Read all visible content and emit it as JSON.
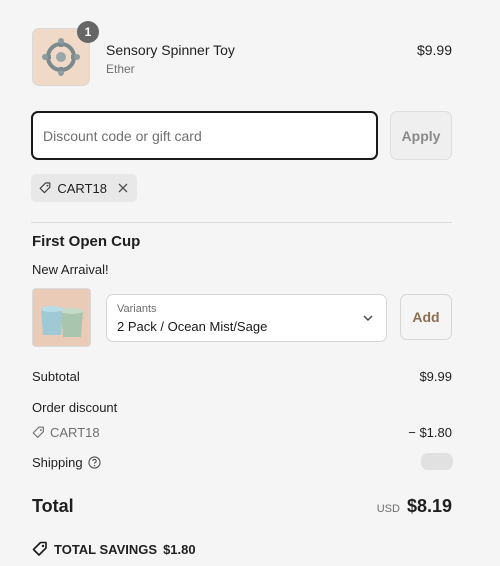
{
  "cart_item": {
    "quantity": "1",
    "title": "Sensory Spinner Toy",
    "variant": "Ether",
    "price": "$9.99",
    "image_icon": "spinner-toy-image"
  },
  "discount": {
    "placeholder": "Discount code or gift card",
    "value": "",
    "apply_label": "Apply",
    "applied_code": "CART18"
  },
  "upsell": {
    "title": "First Open Cup",
    "subtitle": "New Arraival!",
    "variant_label": "Variants",
    "variant_value": "2 Pack / Ocean Mist/Sage",
    "add_label": "Add"
  },
  "summary": {
    "subtotal_label": "Subtotal",
    "subtotal_value": "$9.99",
    "order_discount_label": "Order discount",
    "discount_code": "CART18",
    "discount_value": "− $1.80",
    "shipping_label": "Shipping",
    "total_label": "Total",
    "currency": "USD",
    "total_value": "$8.19",
    "savings_label": "TOTAL SAVINGS",
    "savings_value": "$1.80"
  },
  "colors": {
    "background": "#f5f5f5",
    "accent": "#8b6f52",
    "border": "#d6d6d6"
  }
}
